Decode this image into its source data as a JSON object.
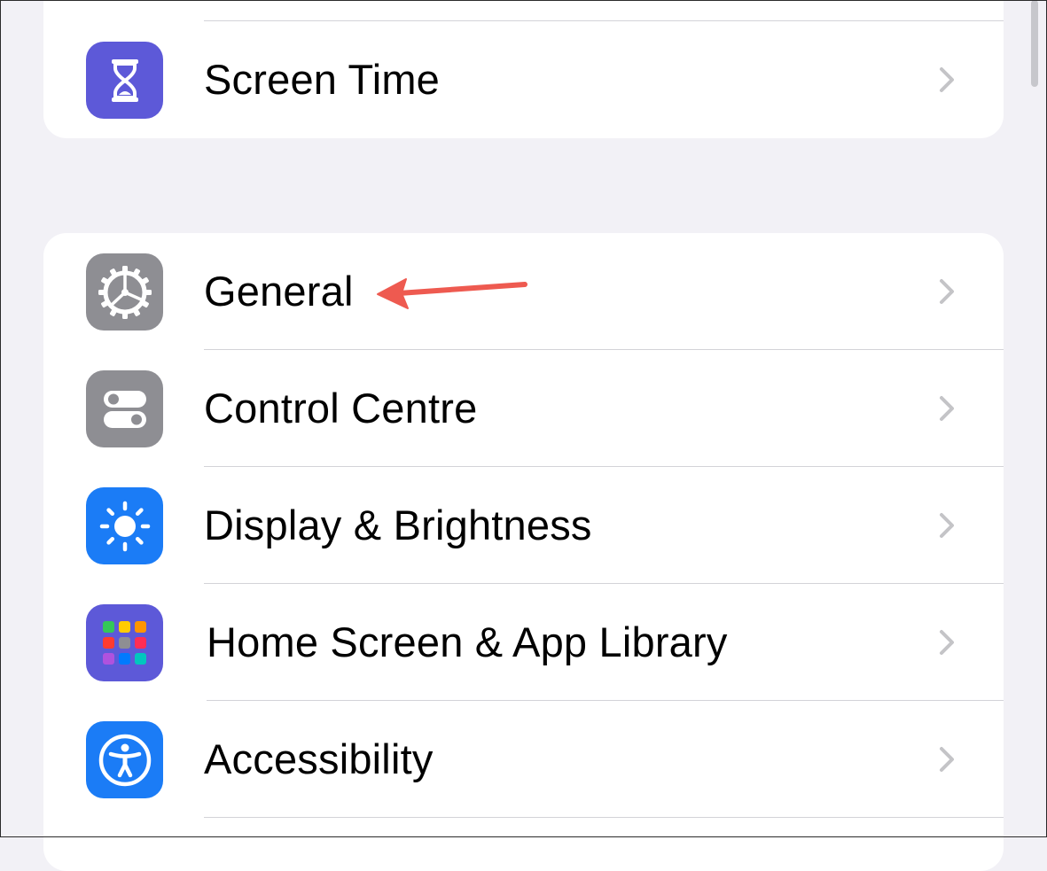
{
  "settings": {
    "top_group": [
      {
        "label": "Screen Time",
        "icon": "hourglass-icon",
        "icon_bg": "#5d59d8"
      }
    ],
    "main_group": [
      {
        "label": "General",
        "icon": "gear-icon",
        "icon_bg": "#8e8e93"
      },
      {
        "label": "Control Centre",
        "icon": "toggles-icon",
        "icon_bg": "#8e8e93"
      },
      {
        "label": "Display & Brightness",
        "icon": "sun-icon",
        "icon_bg": "#1b7cf6"
      },
      {
        "label": "Home Screen & App Library",
        "icon": "app-grid-icon",
        "icon_bg": "#5d59d8"
      },
      {
        "label": "Accessibility",
        "icon": "accessibility-icon",
        "icon_bg": "#1b7cf6"
      }
    ]
  },
  "annotation": {
    "arrow_color": "#ee5a50",
    "points_to": "General"
  },
  "colors": {
    "background": "#f2f1f6",
    "card": "#ffffff",
    "separator": "#d3d3d8",
    "chevron": "#c4c4c7"
  }
}
